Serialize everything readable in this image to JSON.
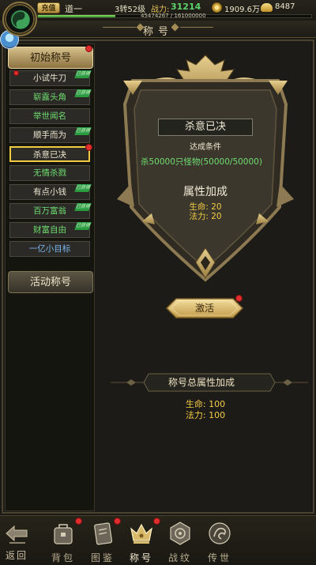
{
  "header": {
    "vip_label": "充值",
    "player_name": "道一",
    "level": "3转52级",
    "power_label": "战力:",
    "power_value": "31214",
    "exp_text": "45474267 / 161000000",
    "exp_ratio": 0.282,
    "coins": "1909.6万",
    "ingots": "8487"
  },
  "page_title": "称号",
  "sidebar": {
    "category_active": "初始称号",
    "category_inactive": "活动称号",
    "items": [
      {
        "label": "小试牛刀",
        "color": "white",
        "tag": "已获得"
      },
      {
        "label": "崭露头角",
        "color": "green",
        "tag": "已获得"
      },
      {
        "label": "举世闻名",
        "color": "green",
        "tag": ""
      },
      {
        "label": "顺手而为",
        "color": "white",
        "tag": "已获得"
      },
      {
        "label": "杀意已决",
        "color": "white",
        "tag": "",
        "selected": true
      },
      {
        "label": "无情杀戮",
        "color": "green",
        "tag": ""
      },
      {
        "label": "有点小钱",
        "color": "white",
        "tag": "已获得"
      },
      {
        "label": "百万富翁",
        "color": "green",
        "tag": "已获得"
      },
      {
        "label": "财富自由",
        "color": "green",
        "tag": "已获得"
      },
      {
        "label": "一亿小目标",
        "color": "blue",
        "tag": ""
      }
    ]
  },
  "detail": {
    "title_name": "杀意已决",
    "condition_label": "达成条件",
    "condition_text": "杀50000只怪物(50000/50000)",
    "attr_title": "属性加成",
    "attr_hp": "生命: 20",
    "attr_mp": "法力: 20",
    "activate_label": "激活"
  },
  "total": {
    "title": "称号总属性加成",
    "hp": "生命: 100",
    "mp": "法力: 100"
  },
  "bottom_nav": {
    "back": "返回",
    "bag": "背包",
    "atlas": "图鉴",
    "title": "称号",
    "battle": "战纹",
    "legend": "传世"
  },
  "colors": {
    "accent_gold": "#f2cb43",
    "green_text": "#6fdc70",
    "red_dot": "#e02d2d"
  }
}
